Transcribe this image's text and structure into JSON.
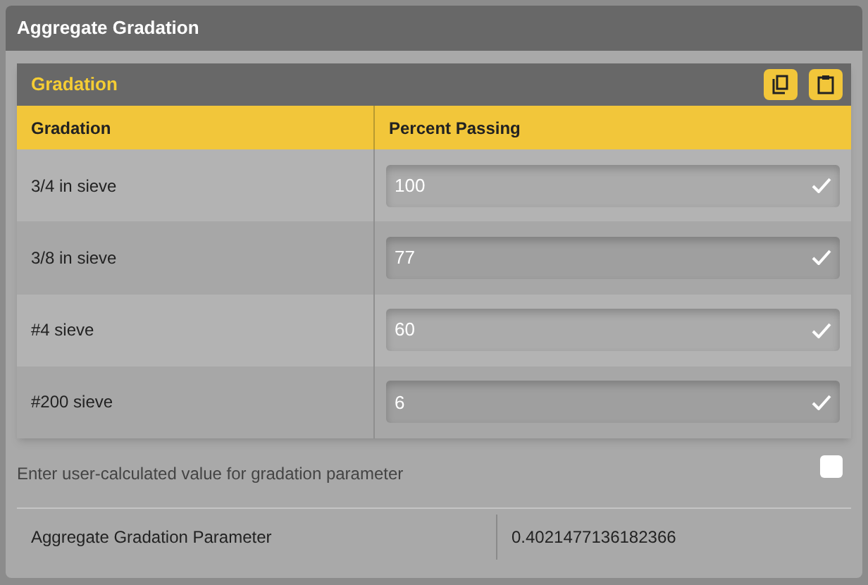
{
  "window": {
    "title": "Aggregate Gradation"
  },
  "card": {
    "title": "Gradation",
    "columns": [
      "Gradation",
      "Percent Passing"
    ],
    "rows": [
      {
        "sieve": "3/4 in sieve",
        "value": "100",
        "valid": true
      },
      {
        "sieve": "3/8 in sieve",
        "value": "77",
        "valid": true
      },
      {
        "sieve": "#4 sieve",
        "value": "60",
        "valid": true
      },
      {
        "sieve": "#200 sieve",
        "value": "6",
        "valid": true
      }
    ]
  },
  "user_value": {
    "label": "Enter user-calculated value for gradation parameter",
    "checked": false
  },
  "result": {
    "label": "Aggregate Gradation Parameter",
    "value": "0.4021477136182366"
  }
}
